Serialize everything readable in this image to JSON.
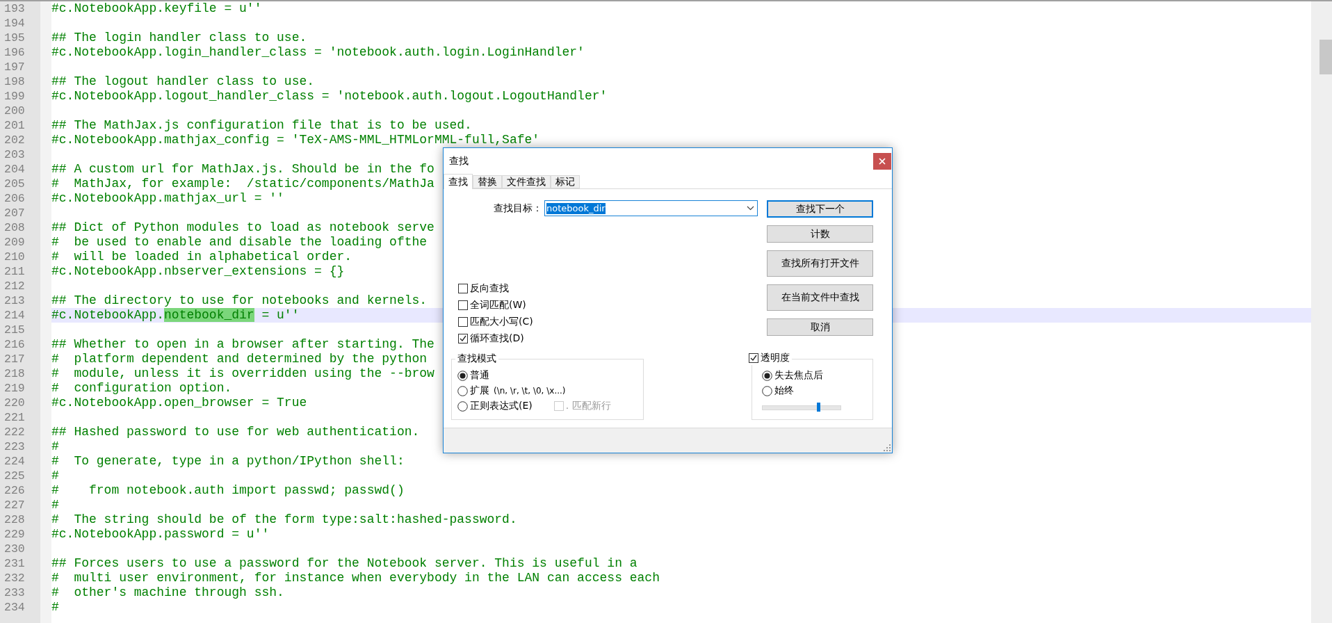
{
  "editor": {
    "lines": [
      {
        "number": "193",
        "current": false,
        "text": "#c.NotebookApp.keyfile = u''"
      },
      {
        "number": "194",
        "current": false
      },
      {
        "number": "195",
        "current": false,
        "text": "## The login handler class to use."
      },
      {
        "number": "196",
        "current": false,
        "text": "#c.NotebookApp.login_handler_class = 'notebook.auth.login.LoginHandler'"
      },
      {
        "number": "197",
        "current": false
      },
      {
        "number": "198",
        "current": false,
        "text": "## The logout handler class to use."
      },
      {
        "number": "199",
        "current": false,
        "text": "#c.NotebookApp.logout_handler_class = 'notebook.auth.logout.LogoutHandler'"
      },
      {
        "number": "200",
        "current": false
      },
      {
        "number": "201",
        "current": false,
        "text": "## The MathJax.js configuration file that is to be used."
      },
      {
        "number": "202",
        "current": false,
        "text": "#c.NotebookApp.mathjax_config = 'TeX-AMS-MML_HTMLorMML-full,Safe'"
      },
      {
        "number": "203",
        "current": false
      },
      {
        "number": "204",
        "current": false,
        "text": "## A custom url for MathJax.js. Should be in the fo"
      },
      {
        "number": "205",
        "current": false,
        "text": "#  MathJax, for example:  /static/components/MathJa"
      },
      {
        "number": "206",
        "current": false,
        "text": "#c.NotebookApp.mathjax_url = ''"
      },
      {
        "number": "207",
        "current": false
      },
      {
        "number": "208",
        "current": false,
        "text": "## Dict of Python modules to load as notebook serve"
      },
      {
        "number": "209",
        "current": false,
        "text": "#  be used to enable and disable the loading ofthe"
      },
      {
        "number": "210",
        "current": false,
        "text": "#  will be loaded in alphabetical order."
      },
      {
        "number": "211",
        "current": false,
        "text": "#c.NotebookApp.nbserver_extensions = {}"
      },
      {
        "number": "212",
        "current": false
      },
      {
        "number": "213",
        "current": false,
        "text": "## The directory to use for notebooks and kernels."
      },
      {
        "number": "214",
        "current": true,
        "segments": [
          {
            "text": "#c.NotebookApp.",
            "highlighted": false
          },
          {
            "text": "notebook_dir",
            "highlighted": true
          },
          {
            "text": " = u''",
            "highlighted": false
          }
        ]
      },
      {
        "number": "215",
        "current": false
      },
      {
        "number": "216",
        "current": false,
        "text": "## Whether to open in a browser after starting. The"
      },
      {
        "number": "217",
        "current": false,
        "text": "#  platform dependent and determined by the python"
      },
      {
        "number": "218",
        "current": false,
        "text": "#  module, unless it is overridden using the --brow"
      },
      {
        "number": "219",
        "current": false,
        "text": "#  configuration option."
      },
      {
        "number": "220",
        "current": false,
        "text": "#c.NotebookApp.open_browser = True"
      },
      {
        "number": "221",
        "current": false
      },
      {
        "number": "222",
        "current": false,
        "text": "## Hashed password to use for web authentication."
      },
      {
        "number": "223",
        "current": false,
        "text": "#"
      },
      {
        "number": "224",
        "current": false,
        "text": "#  To generate, type in a python/IPython shell:"
      },
      {
        "number": "225",
        "current": false,
        "text": "#"
      },
      {
        "number": "226",
        "current": false,
        "text": "#    from notebook.auth import passwd; passwd()"
      },
      {
        "number": "227",
        "current": false,
        "text": "#"
      },
      {
        "number": "228",
        "current": false,
        "text": "#  The string should be of the form type:salt:hashed-password."
      },
      {
        "number": "229",
        "current": false,
        "text": "#c.NotebookApp.password = u''"
      },
      {
        "number": "230",
        "current": false
      },
      {
        "number": "231",
        "current": false,
        "text": "## Forces users to use a password for the Notebook server. This is useful in a"
      },
      {
        "number": "232",
        "current": false,
        "text": "#  multi user environment, for instance when everybody in the LAN can access each"
      },
      {
        "number": "233",
        "current": false,
        "text": "#  other's machine through ssh."
      },
      {
        "number": "234",
        "current": false,
        "text": "#"
      }
    ]
  },
  "find_dialog": {
    "title": "查找",
    "tabs": [
      {
        "label": "查找",
        "selected": true
      },
      {
        "label": "替换",
        "selected": false
      },
      {
        "label": "文件查找",
        "selected": false
      },
      {
        "label": "标记",
        "selected": false
      }
    ],
    "target_label": "查找目标：",
    "target_value": "notebook_dir",
    "buttons": [
      {
        "label": "查找下一个",
        "focused": true
      },
      {
        "label": "计数",
        "focused": false
      },
      {
        "label": "查找所有打开文件",
        "focused": false
      },
      {
        "label": "在当前文件中查找",
        "focused": false
      },
      {
        "label": "取消",
        "focused": false
      }
    ],
    "options": [
      {
        "label": "反向查找",
        "checked": false
      },
      {
        "label": "全词匹配(W)",
        "checked": false
      },
      {
        "label": "匹配大小写(C)",
        "checked": false
      },
      {
        "label": "循环查找(D)",
        "checked": true
      }
    ],
    "mode": {
      "title": "查找模式",
      "options": [
        {
          "label": "普通",
          "selected": true
        },
        {
          "label": "扩展",
          "hint": "(\\n, \\r, \\t, \\0, \\x...)",
          "selected": false
        },
        {
          "label": "正则表达式(E)",
          "selected": false
        }
      ],
      "newline": {
        "label": ". 匹配新行",
        "checked": false,
        "disabled": true
      }
    },
    "transparency": {
      "label": "透明度",
      "checked": true,
      "options": [
        {
          "label": "失去焦点后",
          "selected": true
        },
        {
          "label": "始终",
          "selected": false
        }
      ],
      "level": 0.71
    }
  }
}
